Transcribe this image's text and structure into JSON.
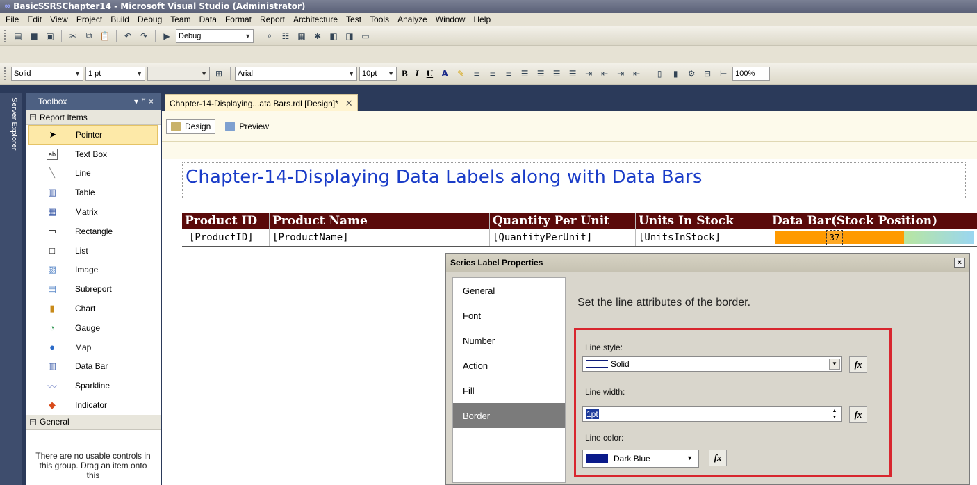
{
  "window": {
    "title": "BasicSSRSChapter14 - Microsoft Visual Studio (Administrator)"
  },
  "menu": [
    "File",
    "Edit",
    "View",
    "Project",
    "Build",
    "Debug",
    "Team",
    "Data",
    "Format",
    "Report",
    "Architecture",
    "Test",
    "Tools",
    "Analyze",
    "Window",
    "Help"
  ],
  "toolbar1": {
    "config": "Debug"
  },
  "toolbar2": {
    "border_style": "Solid",
    "border_width": "1 pt",
    "font_family": "Arial",
    "font_size": "10pt",
    "bold": "B",
    "italic": "I",
    "underline": "U",
    "zoom": "100%"
  },
  "sidebar": {
    "server_explorer": "Server Explorer"
  },
  "toolbox": {
    "title": "Toolbox",
    "group_report_items": "Report Items",
    "items": [
      {
        "label": "Pointer",
        "icon": "pointer-icon"
      },
      {
        "label": "Text Box",
        "icon": "textbox-icon"
      },
      {
        "label": "Line",
        "icon": "line-icon"
      },
      {
        "label": "Table",
        "icon": "table-icon"
      },
      {
        "label": "Matrix",
        "icon": "matrix-icon"
      },
      {
        "label": "Rectangle",
        "icon": "rectangle-icon"
      },
      {
        "label": "List",
        "icon": "list-icon"
      },
      {
        "label": "Image",
        "icon": "image-icon"
      },
      {
        "label": "Subreport",
        "icon": "subreport-icon"
      },
      {
        "label": "Chart",
        "icon": "chart-icon"
      },
      {
        "label": "Gauge",
        "icon": "gauge-icon"
      },
      {
        "label": "Map",
        "icon": "map-icon"
      },
      {
        "label": "Data Bar",
        "icon": "databar-icon"
      },
      {
        "label": "Sparkline",
        "icon": "sparkline-icon"
      },
      {
        "label": "Indicator",
        "icon": "indicator-icon"
      }
    ],
    "group_general": "General",
    "empty_message": "There are no usable controls in this group. Drag an item onto this"
  },
  "document": {
    "tab_title": "Chapter-14-Displaying...ata Bars.rdl [Design]*",
    "view_design": "Design",
    "view_preview": "Preview"
  },
  "report": {
    "title": "Chapter-14-Displaying Data Labels along with Data Bars",
    "headers": [
      "Product ID",
      "Product Name",
      "Quantity Per Unit",
      "Units In Stock",
      "Data Bar(Stock Position)"
    ],
    "row": [
      "[ProductID]",
      "[ProductName]",
      "[QuantityPerUnit]",
      "[UnitsInStock]"
    ],
    "databar_label": "37"
  },
  "dialog": {
    "title": "Series Label Properties",
    "close": "×",
    "nav": [
      "General",
      "Font",
      "Number",
      "Action",
      "Fill",
      "Border"
    ],
    "active_nav": "Border",
    "description": "Set the line attributes of the border.",
    "line_style_label": "Line style:",
    "line_style_value": "Solid",
    "line_width_label": "Line width:",
    "line_width_value": "1pt",
    "line_color_label": "Line color:",
    "line_color_value": "Dark Blue",
    "fx": "fx"
  },
  "colors": {
    "accent_blue": "#1a3cc8",
    "header_maroon": "#5a0a0a",
    "databar_orange": "#ff9a00",
    "highlight_red": "#d8262e",
    "dark_blue": "#0a1a8a"
  }
}
